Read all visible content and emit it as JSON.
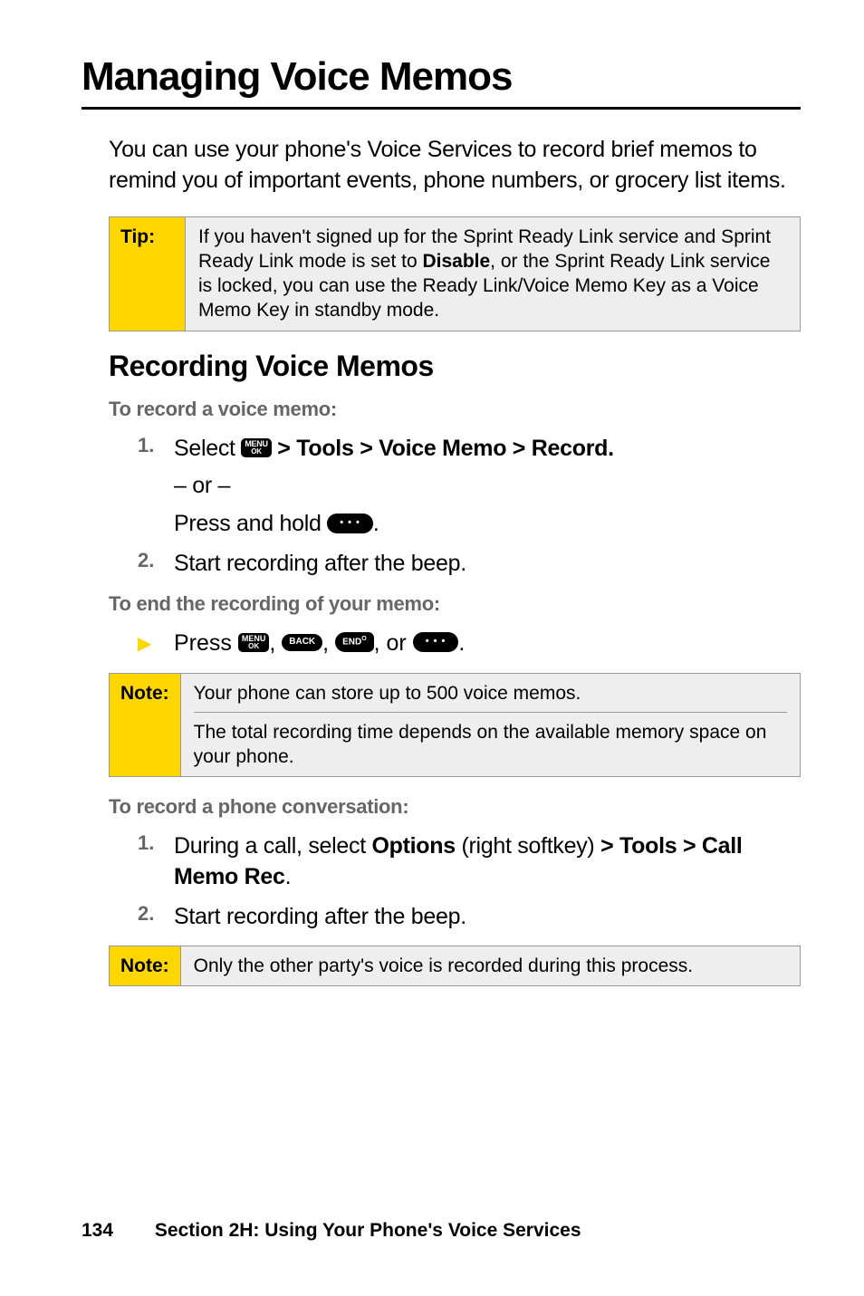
{
  "title": "Managing Voice Memos",
  "intro": "You can use your phone's Voice Services to record brief memos to remind you of important events, phone numbers, or grocery list items.",
  "tip": {
    "label": "Tip:",
    "body_before": "If you haven't signed up for the Sprint Ready Link service and Sprint Ready Link mode is set to ",
    "body_bold": "Disable",
    "body_after": ", or the Sprint Ready Link service is locked, you can use the Ready Link/Voice Memo Key as a Voice Memo Key in standby mode."
  },
  "section1": {
    "heading": "Recording Voice Memos",
    "sub1": "To record a voice memo:",
    "step1_prefix": "Select ",
    "step1_menu": " > Tools > Voice Memo > Record",
    "step1_or": "– or –",
    "step1_press": "Press and hold ",
    "step2": "Start recording after the beep.",
    "sub2": "To end the recording of your memo:",
    "press_line_prefix": "Press ",
    "press_line_sep": ", ",
    "press_line_or": ", or "
  },
  "note1": {
    "label": "Note:",
    "line1": "Your phone can store up to 500 voice memos.",
    "line2": "The total recording time depends on the available memory space on your phone."
  },
  "section2": {
    "sub": "To record a phone  conversation:",
    "step1_prefix": "During a call, select ",
    "step1_bold1": "Options",
    "step1_mid": " (right softkey) ",
    "step1_bold2": "> Tools > Call Memo Rec",
    "step2": "Start recording after the beep."
  },
  "note2": {
    "label": "Note:",
    "body": "Only the other party's voice is recorded during this process."
  },
  "footer": {
    "page": "134",
    "section": "Section 2H: Using Your Phone's Voice Services"
  },
  "icons": {
    "menu_top": "MENU",
    "menu_bottom": "OK",
    "back": "BACK",
    "end": "END",
    "end_icon": "O",
    "dots": "• • •"
  }
}
